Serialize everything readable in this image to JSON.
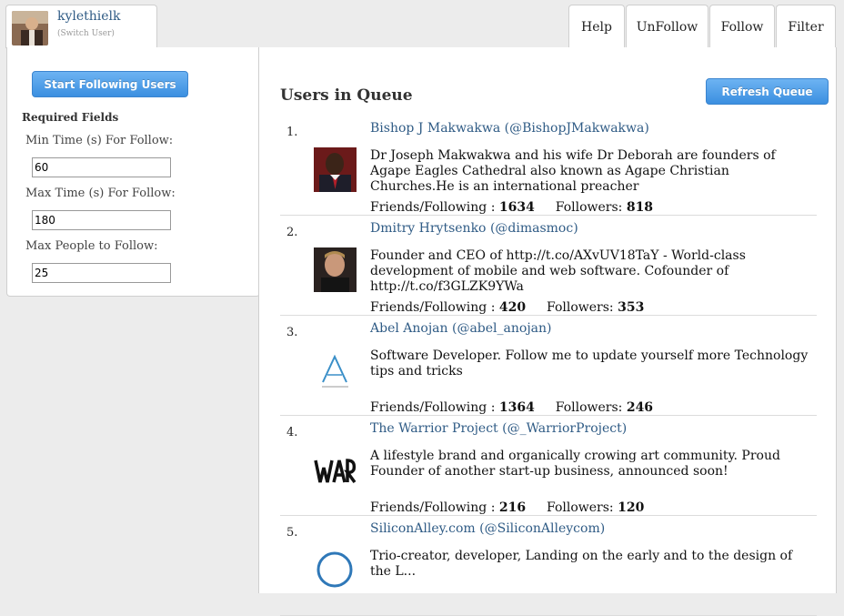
{
  "user": {
    "name": "kylethielk",
    "switch_label": "(Switch User)"
  },
  "tabs": [
    {
      "label": "Help"
    },
    {
      "label": "UnFollow"
    },
    {
      "label": "Follow"
    },
    {
      "label": "Filter"
    }
  ],
  "left_panel": {
    "start_button": "Start Following Users",
    "required_fields": "Required Fields",
    "min_time_label": "Min Time (s) For Follow:",
    "min_time_value": "60",
    "max_time_label": "Max Time (s) For Follow:",
    "max_time_value": "180",
    "max_people_label": "Max People to Follow:",
    "max_people_value": "25"
  },
  "main": {
    "title": "Users in Queue",
    "refresh_button": "Refresh Queue",
    "stats_friends_label": "Friends/Following :",
    "stats_followers_label": "Followers:",
    "queue": [
      {
        "num": "1.",
        "name": "Bishop J Makwakwa (@BishopJMakwakwa)",
        "desc": "Dr Joseph Makwakwa and his wife Dr Deborah are founders of Agape Eagles Cathedral also known as Agape Christian Churches.He is an international preacher",
        "friends": "1634",
        "followers": "818"
      },
      {
        "num": "2.",
        "name": "Dmitry Hrytsenko (@dimasmoc)",
        "desc": "Founder and CEO of http://t.co/AXvUV18TaY - World-class development of mobile and web software. Cofounder of http://t.co/f3GLZK9YWa",
        "friends": "420",
        "followers": "353"
      },
      {
        "num": "3.",
        "name": "Abel Anojan (@abel_anojan)",
        "desc": "Software Developer. Follow me to update yourself more Technology tips and tricks",
        "friends": "1364",
        "followers": "246"
      },
      {
        "num": "4.",
        "name": "The Warrior Project (@_WarriorProject)",
        "desc": "A lifestyle brand and organically crowing art community. Proud Founder of another start-up business, announced soon!",
        "friends": "216",
        "followers": "120"
      },
      {
        "num": "5.",
        "name": "SiliconAlley.com (@SiliconAlleycom)",
        "desc": "Trio-creator, developer, Landing on the early and to the design of the L...",
        "friends": "",
        "followers": ""
      }
    ]
  }
}
